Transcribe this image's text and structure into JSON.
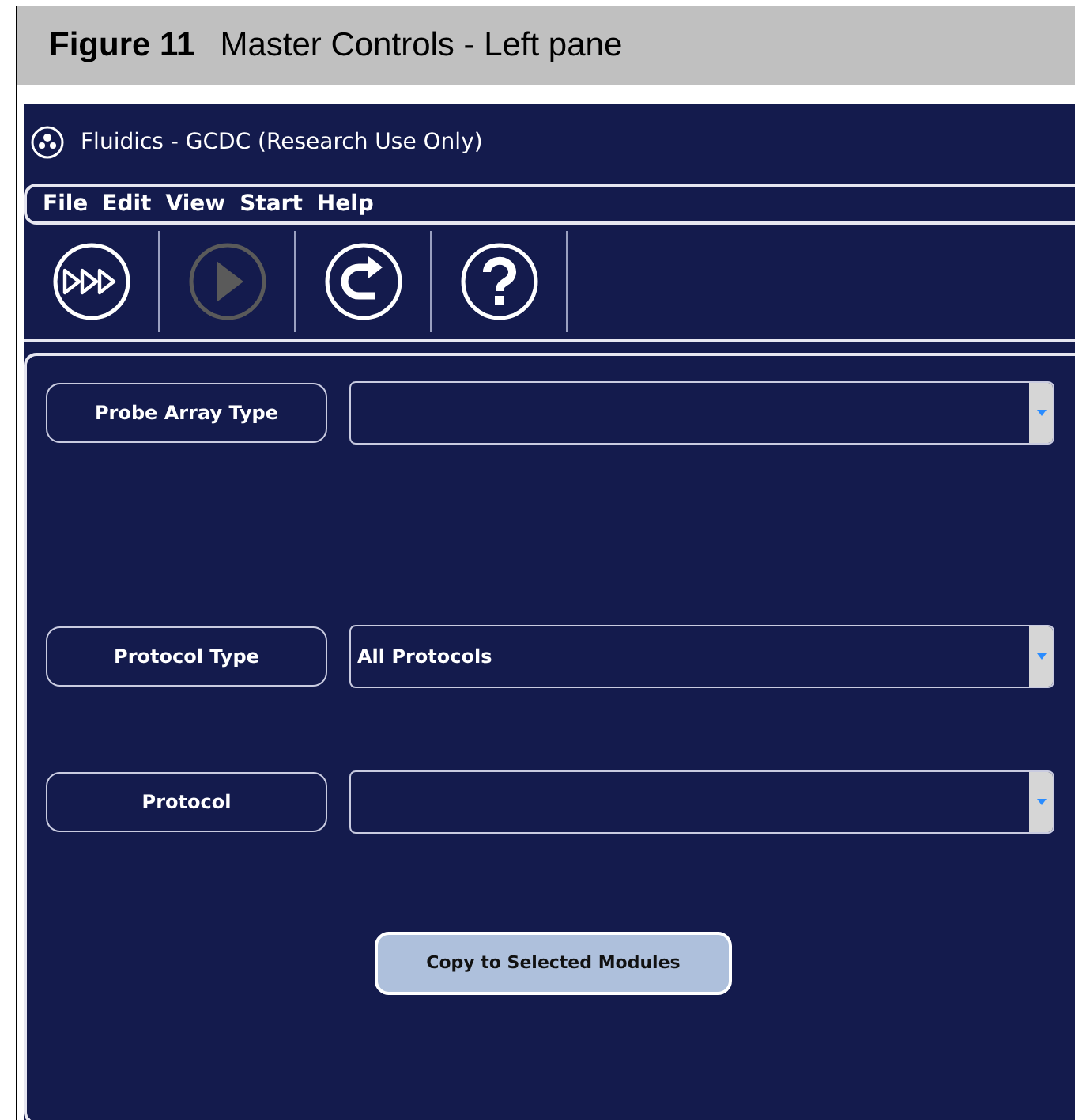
{
  "figure": {
    "number": "Figure 11",
    "caption": "Master Controls - Left pane"
  },
  "window": {
    "title": "Fluidics - GCDC (Research Use Only)"
  },
  "menu": [
    "File",
    "Edit",
    "View",
    "Start",
    "Help"
  ],
  "toolbar": [
    {
      "kind": "run-all",
      "disabled": false
    },
    {
      "kind": "play",
      "disabled": true
    },
    {
      "kind": "redo",
      "disabled": false
    },
    {
      "kind": "help",
      "disabled": false
    }
  ],
  "fields": [
    {
      "label": "Probe Array Type"
    },
    {
      "label": "Protocol Type",
      "value": "All Protocols"
    },
    {
      "label": "Protocol"
    }
  ],
  "copy_button": "Copy to Selected Modules"
}
